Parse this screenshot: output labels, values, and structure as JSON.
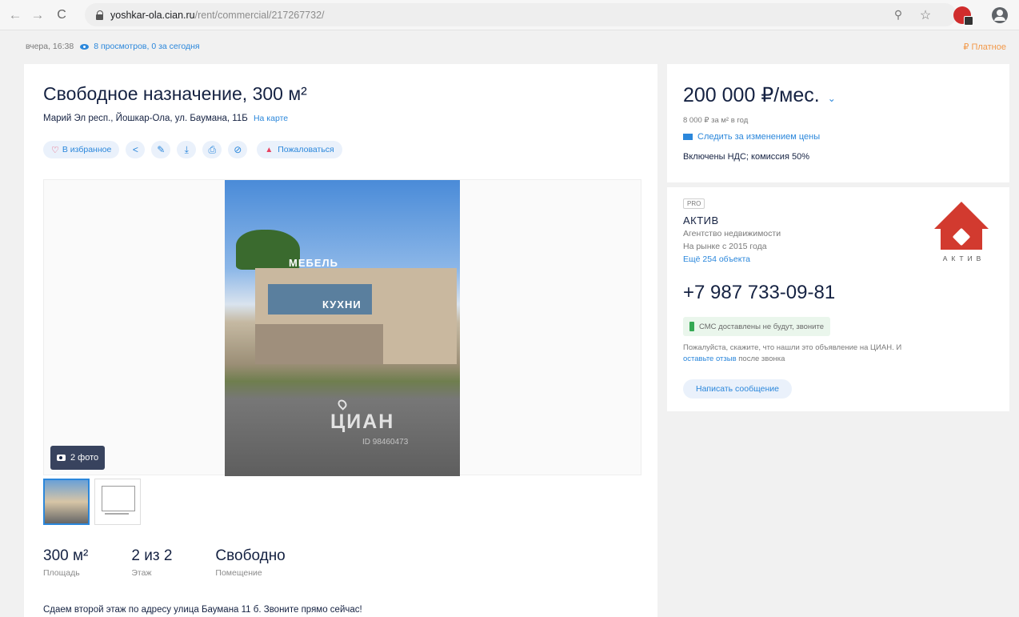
{
  "browser": {
    "url_host": "yoshkar-ola.cian.ru",
    "url_path": "/rent/commercial/217267732/"
  },
  "meta": {
    "date": "вчера, 16:38",
    "views": "8 просмотров, 0 за сегодня",
    "paid": "₽ Платное"
  },
  "listing": {
    "title": "Свободное назначение, 300 м²",
    "address": "Марий Эл респ., Йошкар-Ола, ул. Баумана, 11Б",
    "map_link": "На карте",
    "actions": {
      "favorite": "В избранное",
      "complain": "Пожаловаться"
    },
    "gallery": {
      "photo_count": "2 фото",
      "watermark": "ЦИАН",
      "watermark_id": "ID 98460473",
      "sign_top": "МЕБЕЛЬ",
      "sign_mid": "КУХНИ"
    },
    "stats": [
      {
        "value": "300 м²",
        "label": "Площадь"
      },
      {
        "value": "2 из 2",
        "label": "Этаж"
      },
      {
        "value": "Свободно",
        "label": "Помещение"
      }
    ],
    "description": "Сдаем второй этаж по адресу улица Баумана 11 б. Звоните прямо сейчас!"
  },
  "price": {
    "value": "200 000 ₽/мес.",
    "per_m2": "8 000 ₽ за м² в год",
    "watch": "Следить за изменением цены",
    "included": "Включены НДС; комиссия 50%"
  },
  "agent": {
    "badge": "PRO",
    "name": "АКТИВ",
    "type": "Агентство недвижимости",
    "since": "На рынке с 2015 года",
    "more": "Ещё 254 объекта",
    "logo_text": "АКТИВ",
    "phone": "+7 987 733-09-81",
    "sms_note": "СМС доставлены не будут, звоните",
    "review_text": "Пожалуйста, скажите, что нашли это объявление на ЦИАН. И",
    "review_link": "оставьте отзыв",
    "review_tail": "после звонка",
    "message_button": "Написать сообщение"
  }
}
